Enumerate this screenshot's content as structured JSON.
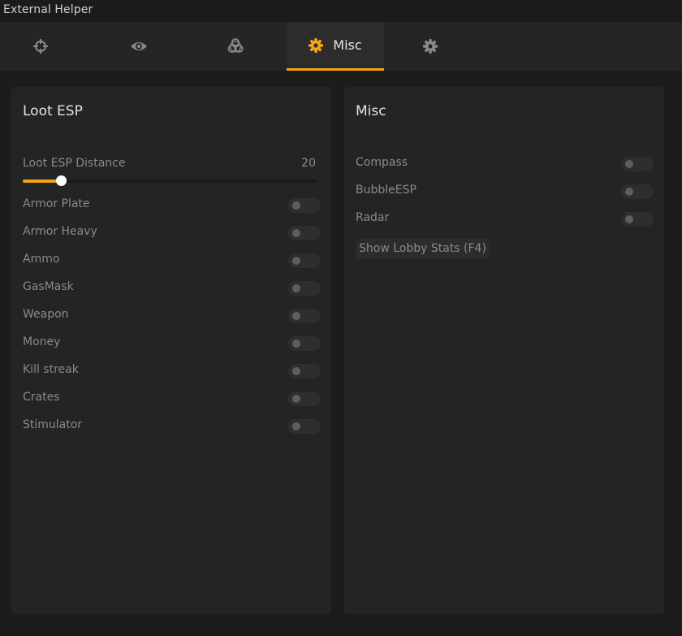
{
  "window": {
    "title": "External Helper"
  },
  "tabs": [
    {
      "icon": "crosshair-icon"
    },
    {
      "icon": "eye-icon"
    },
    {
      "icon": "biohazard-icon"
    },
    {
      "icon": "gear-icon",
      "label": "Misc",
      "active": true
    },
    {
      "icon": "settings-gear-icon"
    }
  ],
  "colors": {
    "accent": "#f7a21b",
    "panel": "#232424",
    "background": "#1b1c1c"
  },
  "loot_esp": {
    "title": "Loot ESP",
    "distance": {
      "label": "Loot ESP Distance",
      "value": "20",
      "fill_fraction": 0.13
    },
    "items": [
      {
        "label": "Armor Plate",
        "enabled": false
      },
      {
        "label": "Armor Heavy",
        "enabled": false
      },
      {
        "label": "Ammo",
        "enabled": false
      },
      {
        "label": "GasMask",
        "enabled": false
      },
      {
        "label": "Weapon",
        "enabled": false
      },
      {
        "label": "Money",
        "enabled": false
      },
      {
        "label": "Kill streak",
        "enabled": false
      },
      {
        "label": "Crates",
        "enabled": false
      },
      {
        "label": "Stimulator",
        "enabled": false
      }
    ]
  },
  "misc": {
    "title": "Misc",
    "items": [
      {
        "label": "Compass",
        "enabled": false
      },
      {
        "label": "BubbleESP",
        "enabled": false
      },
      {
        "label": "Radar",
        "enabled": false
      }
    ],
    "lobby_button": "Show Lobby Stats (F4)"
  }
}
